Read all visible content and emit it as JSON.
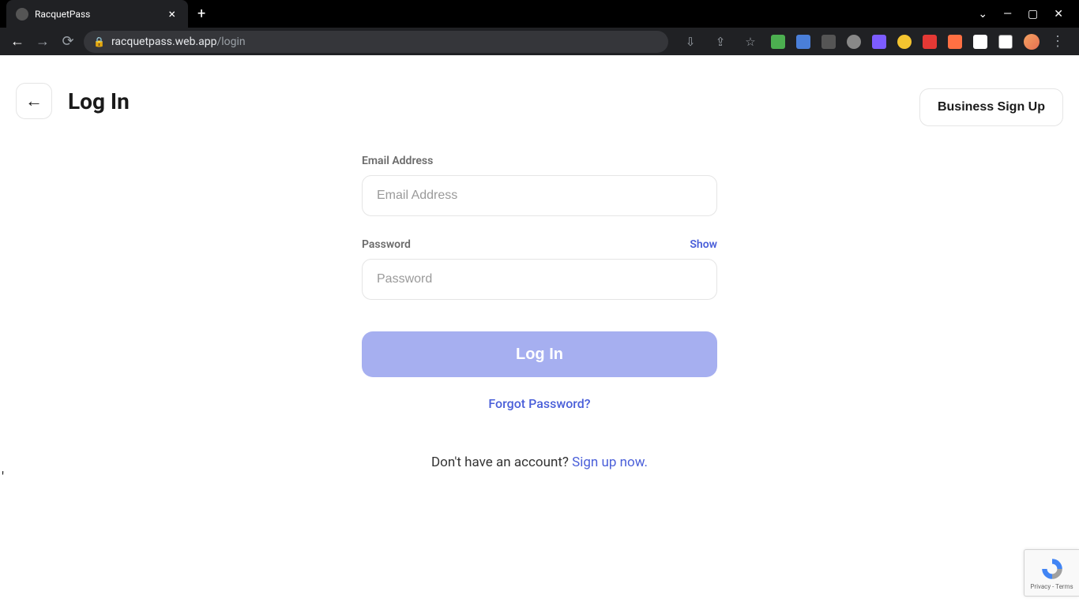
{
  "browser": {
    "tab_title": "RacquetPass",
    "url_host": "racquetpass.web.app",
    "url_path": "/login"
  },
  "header": {
    "title": "Log In",
    "business_signup_label": "Business Sign Up"
  },
  "form": {
    "email_label": "Email Address",
    "email_placeholder": "Email Address",
    "password_label": "Password",
    "password_placeholder": "Password",
    "show_label": "Show",
    "login_button_label": "Log In",
    "forgot_label": "Forgot Password?"
  },
  "signup": {
    "prompt": "Don't have an account? ",
    "link": "Sign up now."
  },
  "recaptcha": {
    "terms": "Privacy - Terms"
  },
  "stray": "'"
}
